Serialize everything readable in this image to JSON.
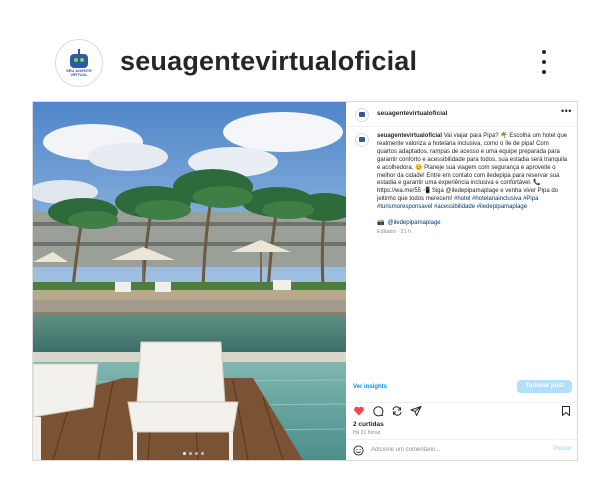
{
  "profile": {
    "username": "seuagentevirtualoficial",
    "avatar_text": "SEU AGENTE VIRTUAL",
    "more_icon": "more-vertical-icon"
  },
  "post": {
    "username": "seuagentevirtualoficial",
    "more_label": "•••",
    "caption_text": "Vai viajar para Pipa? 🌴 Escolha um hotel que realmente valoriza a hotelaria inclusiva, como o Ile de pipa! Com quartos adaptados, rampas de acesso e uma equipe preparada para garantir conforto e acessibilidade para todos, sua estadia será tranquila e acolhedora. 😊 Planeje sua viagem com segurança e aproveite o melhor da cidade! Entre em contato com iledepipa para reservar sua estadia e garantir uma experiência inclusiva e confortável. 📞 https://wa.me/55 📲 Siga @iledepipamaplage e venha viver Pipa do jeitinho que todos merecem!",
    "hashtags": "#hotel #hotelariainclusiva #Pipa #turismoresponsavel #acessibilidade #iledepipamaplage",
    "tagged_handle": "@iledepipamaplage",
    "camera_emoji": "📸",
    "edited_label": "Editado · 21 h",
    "photo_dots": 4,
    "photo_active_dot": 0
  },
  "insights_label": "Ver insights",
  "boost_label": "Turbinar post",
  "likes_label": "2 curtidas",
  "time_label": "Há 21 horas",
  "comment": {
    "placeholder": "Adicione um comentário...",
    "post_label": "Postar"
  },
  "colors": {
    "link_blue": "#0095f6",
    "boost_bg": "#b2dffc",
    "like_red": "#ed4956",
    "text": "#262626",
    "muted": "#8e8e8e"
  },
  "icons": [
    "more-vertical-icon",
    "heart-icon",
    "comment-icon",
    "repost-icon",
    "share-icon",
    "save-icon",
    "emoji-icon"
  ]
}
